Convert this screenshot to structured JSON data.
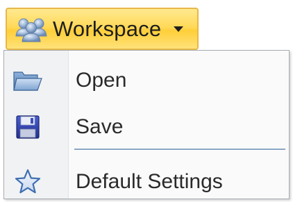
{
  "workspace_button": {
    "label": "Workspace",
    "icon": "workspace-icon",
    "dropdown_icon": "chevron-down-icon",
    "colors": {
      "border": "#e6b84a",
      "fill": "#ffd95a"
    }
  },
  "menu": {
    "items": [
      {
        "label": "Open",
        "icon": "open-folder-icon"
      },
      {
        "label": "Save",
        "icon": "floppy-disk-icon"
      },
      {
        "label": "Default Settings",
        "icon": "star-icon"
      }
    ],
    "separator_after": 1
  }
}
